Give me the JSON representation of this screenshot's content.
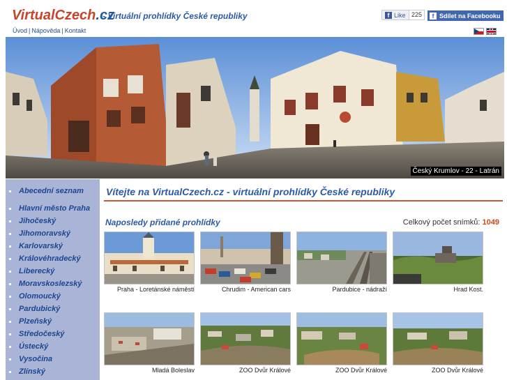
{
  "header": {
    "logo_main": "VirtualCzech",
    "logo_tld": ".cz",
    "tagline": "- Virtuální prohlídky České republiky",
    "nav": [
      "Úvod",
      "Nápověda",
      "Kontakt"
    ],
    "fb_like_label": "Like",
    "fb_like_count": "225",
    "fb_share_label": "Sdílet na Facebooku",
    "languages": [
      "cz",
      "en"
    ]
  },
  "panorama": {
    "caption": "Český Krumlov - 22 - Latrán"
  },
  "sidebar": {
    "items": [
      "Abecední seznam",
      "Hlavní město Praha",
      "Jihočeský",
      "Jihomoravský",
      "Karlovarský",
      "Královéhradecký",
      "Liberecký",
      "Moravskoslezský",
      "Olomoucký",
      "Pardubický",
      "Plzeňský",
      "Středočeský",
      "Ústecký",
      "Vysočina",
      "Zlínský"
    ]
  },
  "main": {
    "welcome": "Vítejte na VirtualCzech.cz - virtuální prohlídky České republiky",
    "recent_title": "Naposledy přidané prohlídky",
    "total_label": "Celkový počet snímků:",
    "total_count": "1049",
    "thumbnails": [
      {
        "caption": "Praha - Loretánské náměstí"
      },
      {
        "caption": "Chrudim - American cars"
      },
      {
        "caption": "Pardubice - nádraží"
      },
      {
        "caption": "Hrad Kost."
      },
      {
        "caption": "Mladá Boleslav"
      },
      {
        "caption": "ZOO Dvůr Králové"
      },
      {
        "caption": "ZOO Dvůr Králové"
      },
      {
        "caption": "ZOO Dvůr Králové"
      }
    ]
  },
  "colors": {
    "accent_red": "#cc5533",
    "link_blue": "#2b5ba8",
    "sidebar_bg": "#a9b4d6",
    "facebook_blue": "#4267b2"
  }
}
